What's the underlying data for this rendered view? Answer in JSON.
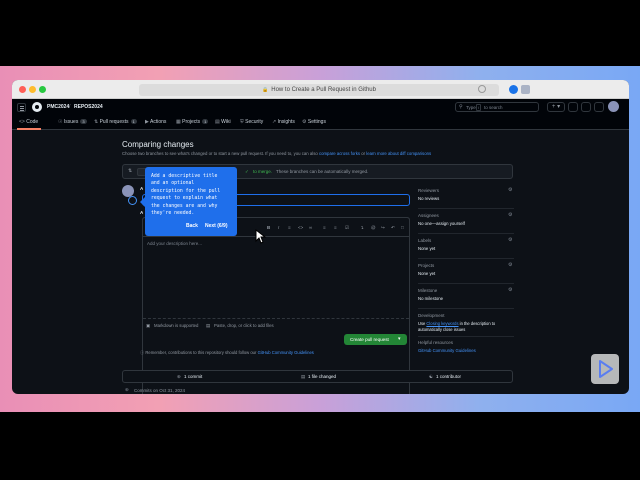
{
  "browser": {
    "page_title": "How to Create a Pull Request in Github"
  },
  "repo": {
    "owner": "PMC2024",
    "sep": "/",
    "name": "REPOS2024",
    "search_placeholder": "Type",
    "search_key": "/",
    "search_suffix": "to search"
  },
  "tabs": [
    {
      "label": "Code",
      "count": ""
    },
    {
      "label": "Issues",
      "count": "3"
    },
    {
      "label": "Pull requests",
      "count": "1"
    },
    {
      "label": "Actions",
      "count": ""
    },
    {
      "label": "Projects",
      "count": "1"
    },
    {
      "label": "Wiki",
      "count": ""
    },
    {
      "label": "Security",
      "count": ""
    },
    {
      "label": "Insights",
      "count": ""
    },
    {
      "label": "Settings",
      "count": ""
    }
  ],
  "compare": {
    "title": "Comparing changes",
    "subtitle": "Choose two branches to see what's changed or to start a new pull request. If you need to, you can also",
    "link1": "compare across forks",
    "or": "or",
    "link2": "learn more about diff comparisons",
    "merge_msg_partial": "to merge.",
    "merge_msg_rest": "These branches can be automatically merged."
  },
  "editor": {
    "description_placeholder": "Add your description here...",
    "markdown_note": "Markdown is supported",
    "attach_note": "Paste, drop, or click to add files",
    "create_button": "Create pull request",
    "reminder": "Remember, contributions to this repository should follow our",
    "guidelines_link": "GitHub Community Guidelines"
  },
  "tooltip": {
    "text": "Add a descriptive title\nand an optional\ndescription for the pull\nrequest to explain what\nthe changes are and why\nthey're needed.",
    "back": "Back",
    "next": "Next (6/9)"
  },
  "sidebar": {
    "reviewers_label": "Reviewers",
    "reviewers_value": "No reviews",
    "assignees_label": "Assignees",
    "assignees_value": "No one—assign yourself",
    "labels_label": "Labels",
    "labels_value": "None yet",
    "projects_label": "Projects",
    "projects_value": "None yet",
    "milestone_label": "Milestone",
    "milestone_value": "No milestone",
    "development_label": "Development",
    "development_text1": "Use",
    "development_link": "Closing keywords",
    "development_text2": "in the description to",
    "development_text3": "automatically close issues",
    "helpful_label": "Helpful resources",
    "helpful_link": "GitHub Community Guidelines"
  },
  "stats": {
    "commits": "1 commit",
    "files": "1 file changed",
    "contributors": "1 contributor"
  },
  "commits_on": "Commits on Oct 31, 2024",
  "colors": {
    "accent": "#1f6feb",
    "green": "#238636",
    "link": "#4493f8",
    "bg": "#0d1117"
  }
}
